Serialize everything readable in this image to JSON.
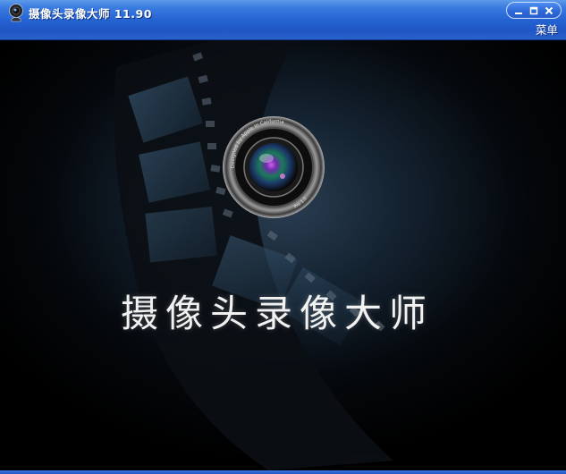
{
  "window": {
    "title": "摄像头录像大师  11.90",
    "menu_label": "菜单",
    "icons": {
      "app": "webcam-icon",
      "minimize": "minimize-icon",
      "maximize": "maximize-icon",
      "close": "close-icon"
    },
    "colors": {
      "titlebar": "#2563d3",
      "background": "#000000"
    }
  },
  "splash": {
    "title": "摄像头录像大师",
    "lens_ring_text": "Designed by Apple in California",
    "lens_ring_text_lower": "Pro 1.0"
  }
}
